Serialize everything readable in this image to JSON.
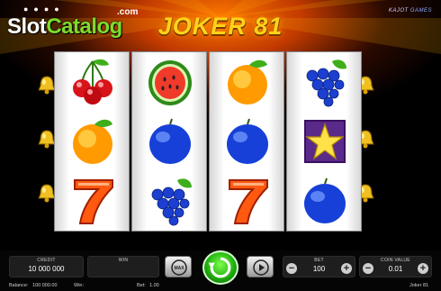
{
  "watermark": {
    "brand": "Slot",
    "brand_accent": "Catalog",
    "tld": ".com",
    "dots": "●●●●"
  },
  "header": {
    "title": "JOKER 81",
    "provider": "KAJOT",
    "provider_suffix": "GAMES"
  },
  "reels": [
    [
      "cherries-icon",
      "orange-icon",
      "seven-icon"
    ],
    [
      "watermelon-icon",
      "plum-icon",
      "grapes-icon"
    ],
    [
      "orange-icon",
      "plum-icon",
      "seven-icon"
    ],
    [
      "grapes-icon",
      "star-icon",
      "plum-icon"
    ]
  ],
  "panels": {
    "credit": {
      "label": "CREDIT",
      "value": "10 000 000"
    },
    "win": {
      "label": "WIN",
      "value": ""
    },
    "max": {
      "label": "MAX"
    },
    "bet": {
      "label": "BET",
      "value": "100",
      "minus": "−",
      "plus": "+"
    },
    "coin_value": {
      "label": "COIN VALUE",
      "value": "0.01",
      "minus": "−",
      "plus": "+"
    }
  },
  "status": {
    "balance_label": "Balance:",
    "balance_value": "100 000.00",
    "win_label": "Win:",
    "win_value": "",
    "bet_label": "Bet:",
    "bet_value": "1.00",
    "game_name": "Joker 81"
  },
  "colors": {
    "title": "#ffd21a",
    "spin": "#21b10e",
    "accent": "#7ddc2c",
    "background": "#ff7a00"
  }
}
